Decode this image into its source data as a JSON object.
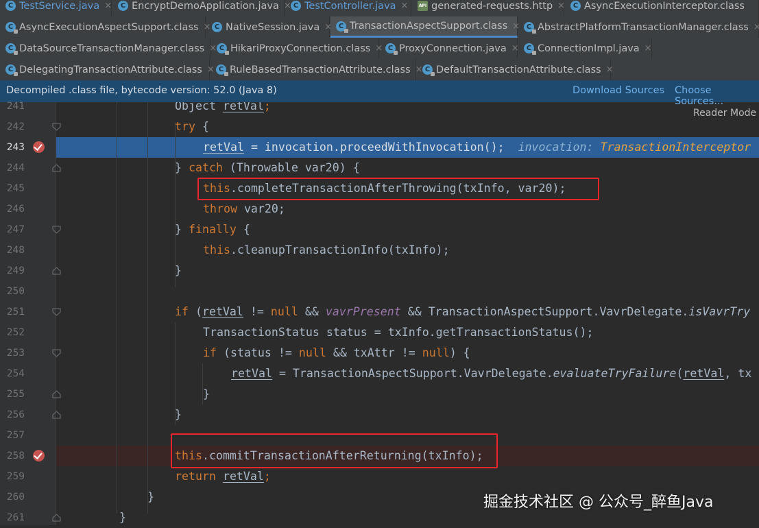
{
  "tabs": {
    "row1": [
      {
        "label": "TestService.java",
        "icon": "C"
      },
      {
        "label": "EncryptDemoApplication.java",
        "icon": "C"
      },
      {
        "label": "TestController.java",
        "icon": "C"
      },
      {
        "label": "generated-requests.http",
        "icon": "API"
      },
      {
        "label": "AsyncExecutionInterceptor.class",
        "icon": "C"
      }
    ],
    "row2": [
      {
        "label": "AsyncExecutionAspectSupport.class",
        "icon": "C"
      },
      {
        "label": "NativeSession.java",
        "icon": "C"
      },
      {
        "label": "TransactionAspectSupport.class",
        "icon": "C"
      },
      {
        "label": "AbstractPlatformTransactionManager.class",
        "icon": "C"
      }
    ],
    "row3": [
      {
        "label": "DataSourceTransactionManager.class",
        "icon": "C"
      },
      {
        "label": "HikariProxyConnection.class",
        "icon": "C"
      },
      {
        "label": "ProxyConnection.java",
        "icon": "C"
      },
      {
        "label": "ConnectionImpl.java",
        "icon": "C"
      }
    ],
    "row4": [
      {
        "label": "DelegatingTransactionAttribute.class",
        "icon": "C"
      },
      {
        "label": "RuleBasedTransactionAttribute.class",
        "icon": "C"
      },
      {
        "label": "DefaultTransactionAttribute.class",
        "icon": "C"
      }
    ],
    "close_glyph": "×"
  },
  "banner": {
    "message": "Decompiled .class file, bytecode version: 52.0 (Java 8)",
    "download_sources": "Download Sources",
    "choose_sources": "Choose Sources..."
  },
  "editor": {
    "reader_mode": "Reader Mode",
    "current_line": 243,
    "breakpoint_lines": [
      243,
      258
    ],
    "line_numbers": [
      "241",
      "242",
      "243",
      "244",
      "245",
      "246",
      "247",
      "248",
      "249",
      "250",
      "251",
      "252",
      "253",
      "254",
      "255",
      "256",
      "257",
      "258",
      "259",
      "260",
      "261"
    ]
  },
  "code": {
    "l241": {
      "kw_object": "Object",
      "var": "retVal",
      "end": ";"
    },
    "l242": {
      "kw": "try",
      "rest": " {"
    },
    "l243": {
      "var": "retVal",
      "rest": " = invocation.proceedWithInvocation();",
      "hint_name": "invocation: ",
      "hint_type": "TransactionInterceptor"
    },
    "l244": {
      "pre": "} ",
      "kw": "catch",
      "rest": " (Throwable var20) {"
    },
    "l245": {
      "kw": "this",
      "rest": ".completeTransactionAfterThrowing(txInfo, var20);"
    },
    "l246": {
      "kw": "throw",
      "rest": " var20;"
    },
    "l247": {
      "pre": "} ",
      "kw": "finally",
      "rest": " {"
    },
    "l248": {
      "kw": "this",
      "rest": ".cleanupTransactionInfo(txInfo);"
    },
    "l249": {
      "text": "}"
    },
    "l251": {
      "kw_if": "if",
      "open": " (",
      "var": "retVal",
      "ne": " != ",
      "kw_null": "null",
      "and": " && ",
      "field": "vavrPresent",
      "and2": " && TransactionAspectSupport.VavrDelegate.",
      "method": "isVavrTry"
    },
    "l252": {
      "text": "TransactionStatus status = txInfo.getTransactionStatus();"
    },
    "l253": {
      "kw_if": "if",
      "a": " (status != ",
      "kw_null1": "null",
      "b": " && txAttr != ",
      "kw_null2": "null",
      "c": ") {"
    },
    "l254": {
      "var": "retVal",
      "mid": " = TransactionAspectSupport.VavrDelegate.",
      "method": "evaluateTryFailure",
      "open": "(",
      "var2": "retVal",
      "tail": ", tx"
    },
    "l255": {
      "text": "}"
    },
    "l256": {
      "text": "}"
    },
    "l258": {
      "kw": "this",
      "rest": ".commitTransactionAfterReturning(txInfo);"
    },
    "l259": {
      "kw": "return",
      "sp": " ",
      "var": "retVal",
      "end": ";"
    },
    "l260": {
      "text": "}"
    },
    "l261": {
      "text": "}"
    }
  },
  "watermark": "掘金技术社区 @ 公众号_醉鱼Java",
  "colors": {
    "background": "#2b2b2b",
    "keyword": "#cc7832",
    "text": "#a9b7c6",
    "field": "#9876aa",
    "execution_line": "#2d6099",
    "breakpoint": "#c75450",
    "highlight_box": "#e8262b",
    "banner": "#1f4a70"
  }
}
